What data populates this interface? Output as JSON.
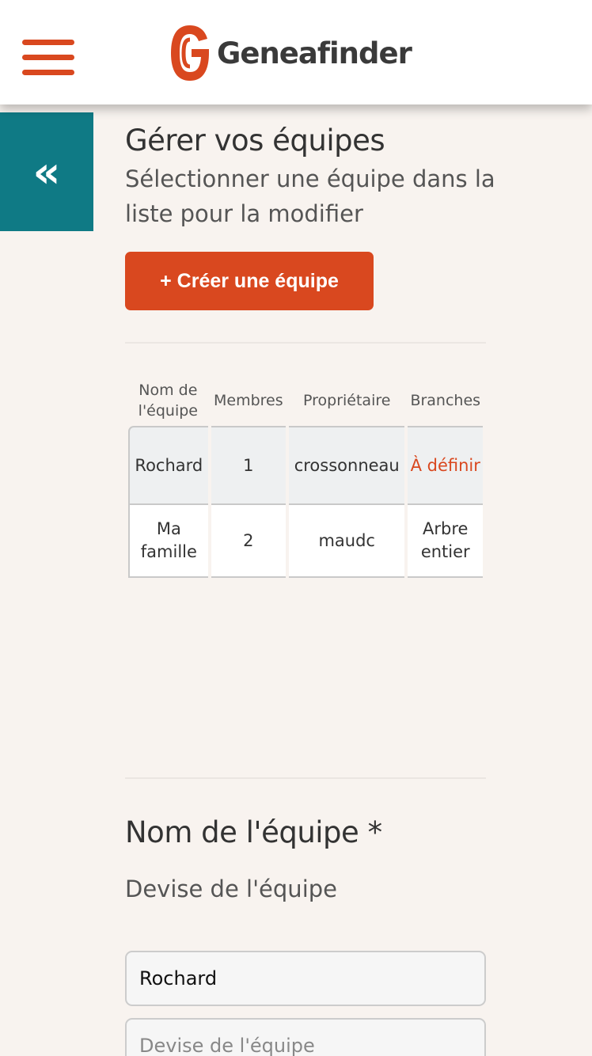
{
  "header": {
    "brand_name": "Geneafinder",
    "brand_color": "#d9481f"
  },
  "sidebar": {
    "collapse_icon": "«"
  },
  "page": {
    "title": "Gérer vos équipes",
    "subtitle": "Sélectionner une équipe dans la liste pour la modifier",
    "create_button": "+ Créer une équipe"
  },
  "table": {
    "columns": [
      "Nom de l'équipe",
      "Membres",
      "Propriétaire",
      "Branches"
    ],
    "rows": [
      {
        "name": "Rochard",
        "members": "1",
        "owner": "crossonneau",
        "branches": "À définir"
      },
      {
        "name": "Ma famille",
        "members": "2",
        "owner": "maudc",
        "branches": "Arbre entier"
      }
    ]
  },
  "form": {
    "name_label": "Nom de l'équipe *",
    "motto_label": "Devise de l'équipe",
    "name_value": "Rochard",
    "motto_placeholder": "Devise de l'équipe"
  },
  "colors": {
    "accent": "#d9481f",
    "teal": "#0f7a85",
    "background": "#f8f3ef"
  }
}
